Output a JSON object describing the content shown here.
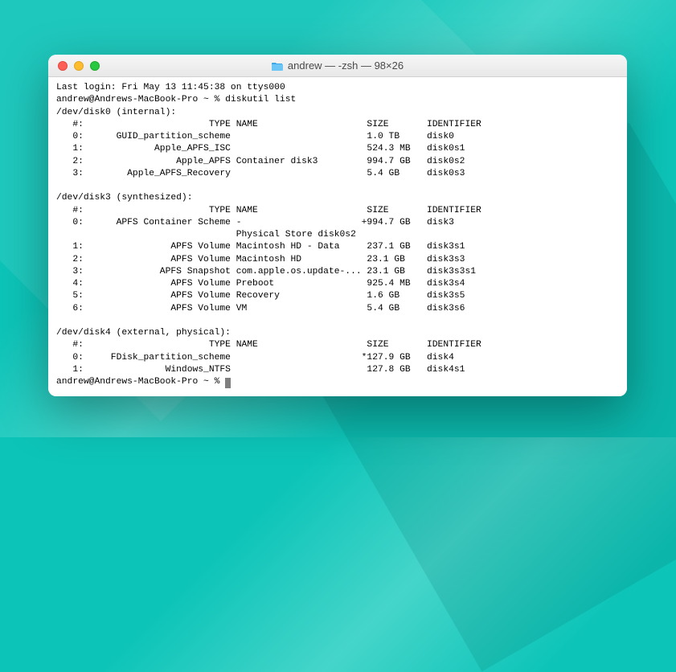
{
  "window": {
    "title": "andrew — -zsh — 98×26"
  },
  "session": {
    "last_login": "Last login: Fri May 13 11:45:38 on ttys000",
    "prompt_prefix": "andrew@Andrews-MacBook-Pro ~ % ",
    "command": "diskutil list"
  },
  "disks": [
    {
      "header": "/dev/disk0 (internal):",
      "columns": "   #:                       TYPE NAME                    SIZE       IDENTIFIER",
      "rows": [
        "   0:      GUID_partition_scheme                         1.0 TB     disk0",
        "   1:             Apple_APFS_ISC                         524.3 MB   disk0s1",
        "   2:                 Apple_APFS Container disk3         994.7 GB   disk0s2",
        "   3:        Apple_APFS_Recovery                         5.4 GB     disk0s3"
      ]
    },
    {
      "header": "/dev/disk3 (synthesized):",
      "columns": "   #:                       TYPE NAME                    SIZE       IDENTIFIER",
      "rows": [
        "   0:      APFS Container Scheme -                      +994.7 GB   disk3",
        "                                 Physical Store disk0s2",
        "   1:                APFS Volume Macintosh HD - Data     237.1 GB   disk3s1",
        "   2:                APFS Volume Macintosh HD            23.1 GB    disk3s3",
        "   3:              APFS Snapshot com.apple.os.update-... 23.1 GB    disk3s3s1",
        "   4:                APFS Volume Preboot                 925.4 MB   disk3s4",
        "   5:                APFS Volume Recovery                1.6 GB     disk3s5",
        "   6:                APFS Volume VM                      5.4 GB     disk3s6"
      ]
    },
    {
      "header": "/dev/disk4 (external, physical):",
      "columns": "   #:                       TYPE NAME                    SIZE       IDENTIFIER",
      "rows": [
        "   0:     FDisk_partition_scheme                        *127.9 GB   disk4",
        "   1:               Windows_NTFS                         127.8 GB   disk4s1"
      ]
    }
  ]
}
